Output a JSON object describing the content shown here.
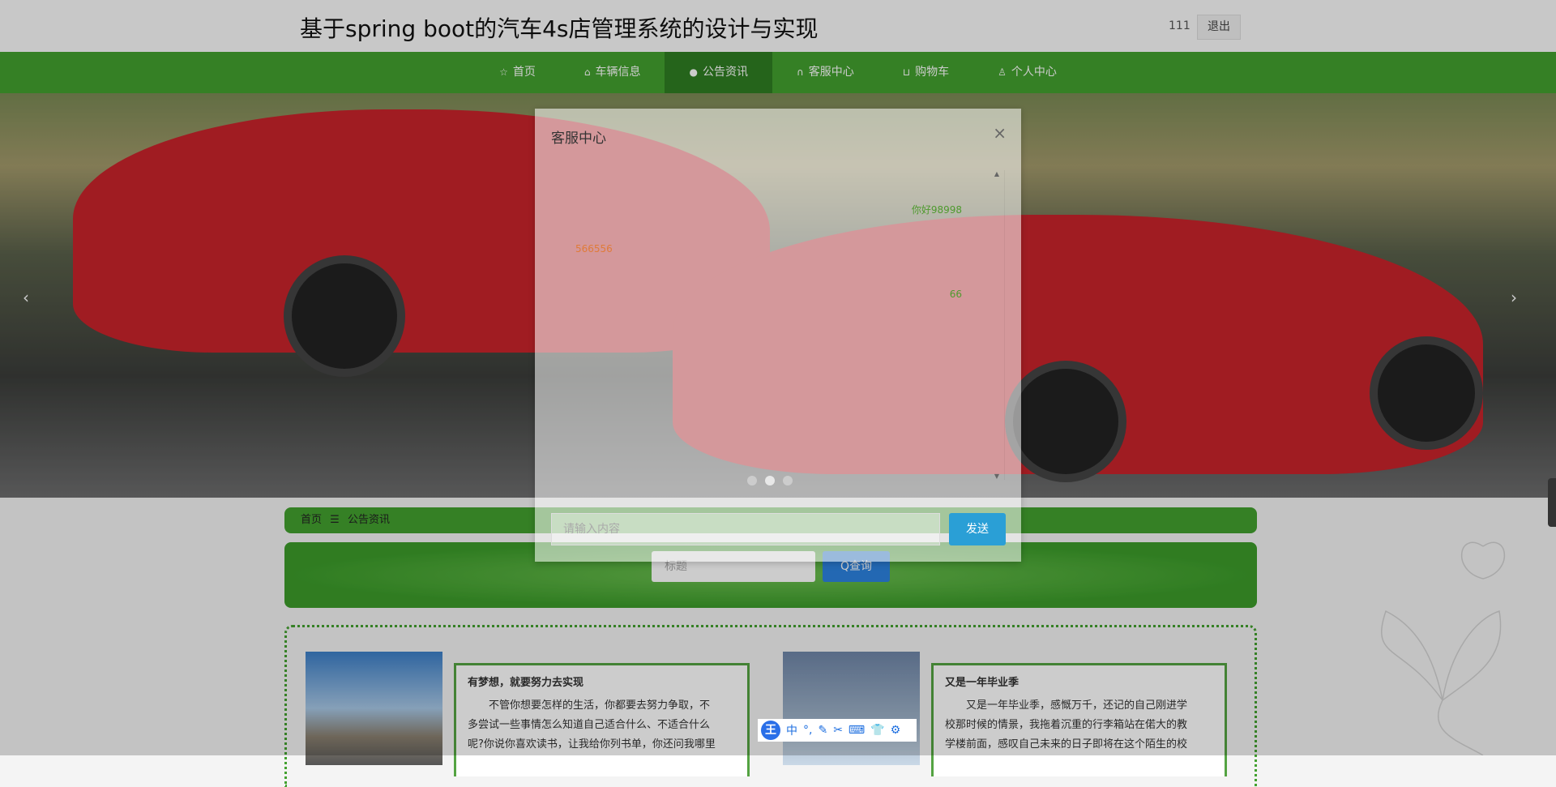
{
  "header": {
    "title": "基于spring boot的汽车4s店管理系统的设计与实现",
    "username": "111",
    "logout_label": "退出"
  },
  "nav": {
    "items": [
      {
        "label": "首页",
        "icon": "star-icon",
        "glyph": "☆"
      },
      {
        "label": "车辆信息",
        "icon": "bag-icon",
        "glyph": "⌂"
      },
      {
        "label": "公告资讯",
        "icon": "info-icon",
        "glyph": "●",
        "active": true
      },
      {
        "label": "客服中心",
        "icon": "headset-icon",
        "glyph": "∩"
      },
      {
        "label": "购物车",
        "icon": "cart-icon",
        "glyph": "⊔"
      },
      {
        "label": "个人中心",
        "icon": "user-icon",
        "glyph": "♙"
      }
    ]
  },
  "banner": {
    "prev": "‹",
    "next": "›",
    "active_slide": 2,
    "slide_count": 3
  },
  "breadcrumb": {
    "home": "首页",
    "separator": "☰",
    "current": "公告资讯"
  },
  "search": {
    "placeholder": "标题",
    "button_label": "查询",
    "button_icon": "Q"
  },
  "cards": [
    {
      "title": "有梦想，就要努力去实现",
      "lines": [
        "　　不管你想要怎样的生活，你都要去努力争取，不",
        "多尝试一些事情怎么知道自己适合什么、不适合什么",
        "呢?你说你喜欢读书，让我给你列书单，你还问我哪里"
      ]
    },
    {
      "title": "又是一年毕业季",
      "lines": [
        "　　又是一年毕业季，感慨万千，还记的自己刚进学",
        "校那时候的情景，我拖着沉重的行李箱站在偌大的教",
        "学楼前面，感叹自己未来的日子即将在这个陌生的校"
      ]
    }
  ],
  "dialog": {
    "title": "客服中心",
    "close": "×",
    "messages": [
      {
        "text": "你好98998",
        "side": "right",
        "color": "#4e9a2e"
      },
      {
        "text": "566556",
        "side": "left",
        "color": "#e07b39"
      },
      {
        "text": "66",
        "side": "right",
        "color": "#4e9a2e"
      }
    ],
    "input_placeholder": "请输入内容",
    "send_label": "发送"
  },
  "ime": {
    "logo": "王",
    "items": [
      "中",
      "°,",
      "✎",
      "✂",
      "⌨",
      "👕",
      "⚙"
    ]
  }
}
